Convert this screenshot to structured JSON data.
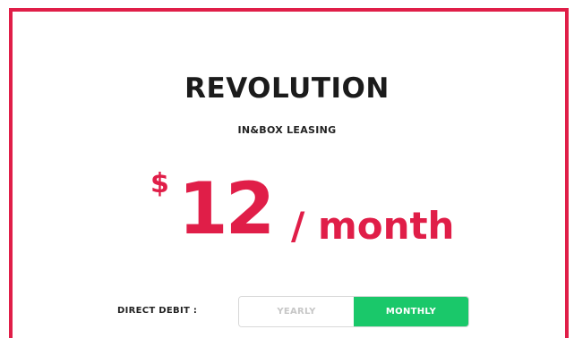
{
  "plan": {
    "name": "REVOLUTION",
    "subtitle": "IN&BOX LEASING"
  },
  "price": {
    "currency": "$",
    "amount": "12",
    "period": "/ month"
  },
  "billing": {
    "label": "DIRECT DEBIT :",
    "options": [
      {
        "label": "YEARLY",
        "selected": false
      },
      {
        "label": "MONTHLY",
        "selected": true
      }
    ]
  },
  "colors": {
    "accent": "#e01e48",
    "selected": "#1ac86a",
    "text": "#1b1b1b"
  }
}
